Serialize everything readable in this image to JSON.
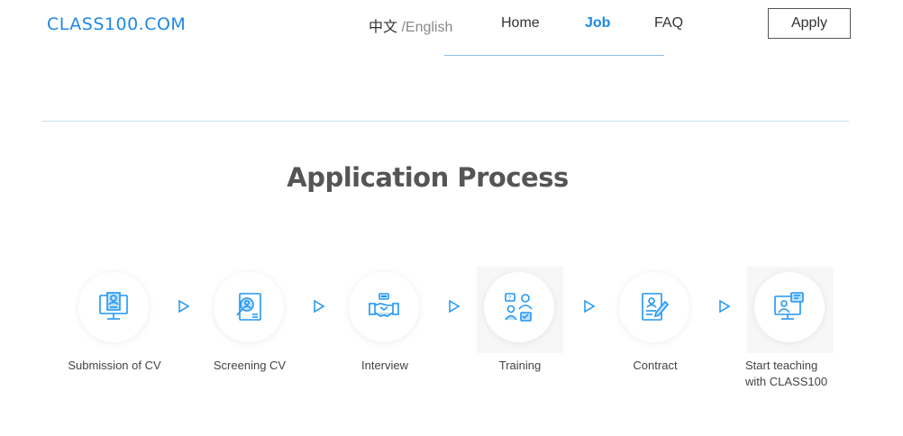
{
  "header": {
    "logo": "CLASS100.COM",
    "lang_zh": "中文",
    "lang_sep": " /",
    "lang_en": "English",
    "nav": {
      "home": "Home",
      "job": "Job",
      "faq": "FAQ"
    },
    "apply": "Apply"
  },
  "section": {
    "title": "Application Process"
  },
  "steps": [
    {
      "label": "Submission of CV",
      "icon": "cv-monitor-icon"
    },
    {
      "label": "Screening CV",
      "icon": "magnifier-document-icon"
    },
    {
      "label": "Interview",
      "icon": "handshake-icon"
    },
    {
      "label": "Training",
      "icon": "training-people-icon"
    },
    {
      "label": "Contract",
      "icon": "contract-pen-icon"
    },
    {
      "label1": "Start teaching",
      "label2": "with CLASS100",
      "icon": "teaching-monitor-icon"
    }
  ],
  "colors": {
    "accent": "#1e88e5",
    "icon": "#2196f3"
  }
}
